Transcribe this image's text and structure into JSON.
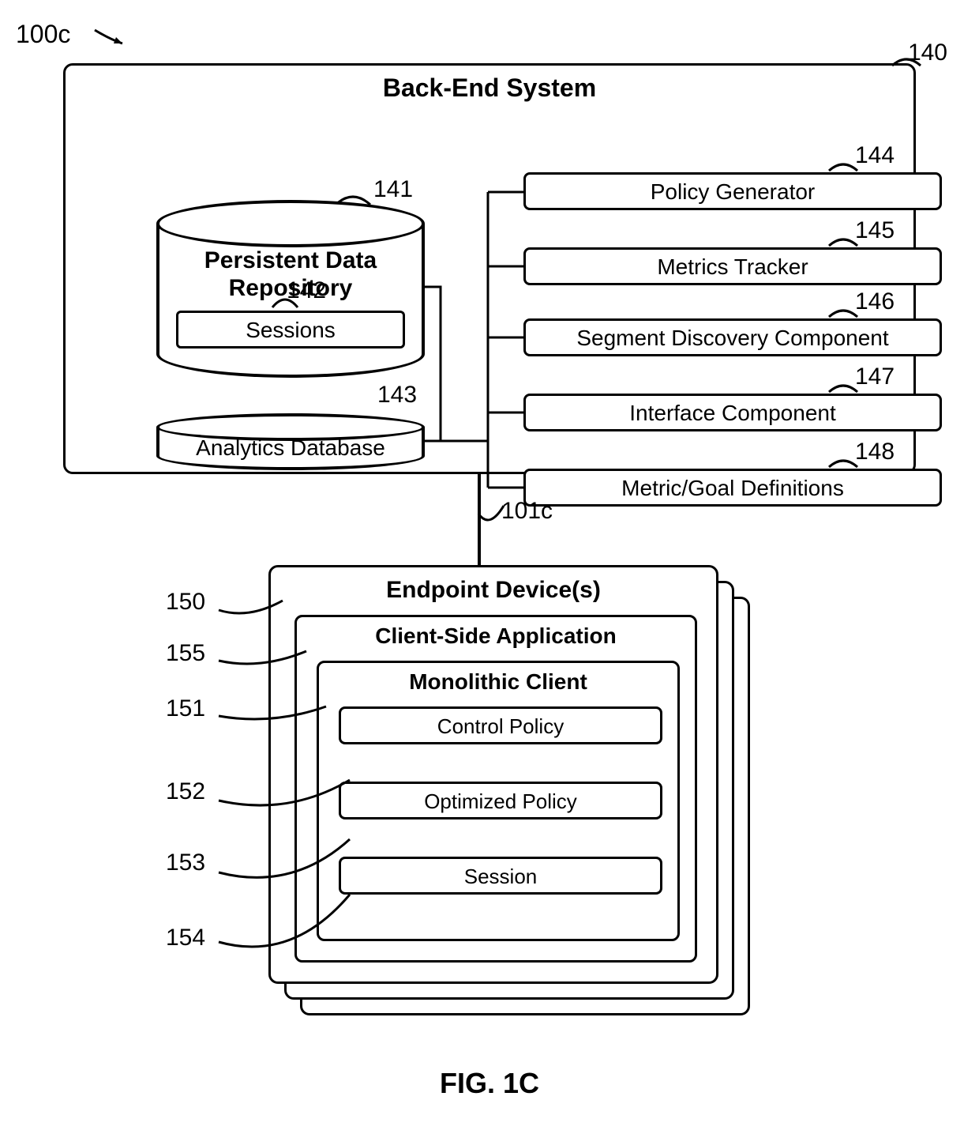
{
  "figure": {
    "ref_overall": "100c",
    "caption": "FIG. 1C",
    "connection_ref": "101c"
  },
  "backend": {
    "title": "Back-End System",
    "ref": "140",
    "repository": {
      "title_line1": "Persistent Data",
      "title_line2": "Repository",
      "ref": "141",
      "sessions": {
        "label": "Sessions",
        "ref": "142"
      }
    },
    "analytics_db": {
      "label": "Analytics Database",
      "ref": "143"
    },
    "components": [
      {
        "label": "Policy Generator",
        "ref": "144"
      },
      {
        "label": "Metrics Tracker",
        "ref": "145"
      },
      {
        "label": "Segment Discovery Component",
        "ref": "146"
      },
      {
        "label": "Interface Component",
        "ref": "147"
      },
      {
        "label": "Metric/Goal Definitions",
        "ref": "148"
      }
    ]
  },
  "endpoint": {
    "title": "Endpoint Device(s)",
    "ref": "150",
    "client_app": {
      "title": "Client-Side Application",
      "ref": "155",
      "monolithic": {
        "title": "Monolithic Client",
        "ref": "151",
        "items": [
          {
            "label": "Control Policy",
            "ref": "152"
          },
          {
            "label": "Optimized Policy",
            "ref": "153"
          },
          {
            "label": "Session",
            "ref": "154"
          }
        ]
      }
    }
  }
}
